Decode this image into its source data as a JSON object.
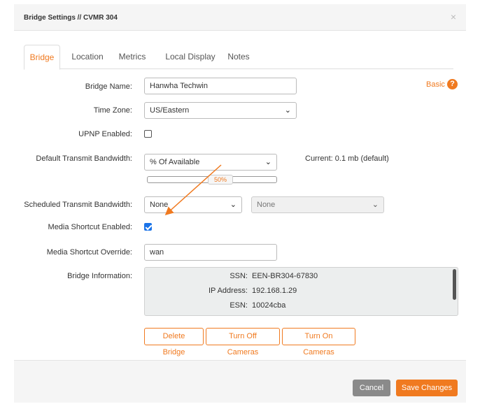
{
  "modal": {
    "title": "Bridge Settings // CVMR 304",
    "close_glyph": "×"
  },
  "tabs": [
    {
      "label": "Bridge",
      "active": true
    },
    {
      "label": "Location"
    },
    {
      "label": "Metrics"
    },
    {
      "label": "Local Display"
    },
    {
      "label": "Notes"
    }
  ],
  "form": {
    "bridge_name_label": "Bridge Name:",
    "bridge_name_value": "Hanwha Techwin",
    "time_zone_label": "Time Zone:",
    "time_zone_value": "US/Eastern",
    "upnp_label": "UPNP Enabled:",
    "upnp_checked": false,
    "bandwidth_label": "Default Transmit Bandwidth:",
    "bandwidth_value": "% Of Available",
    "bandwidth_current": "Current: 0.1 mb (default)",
    "bandwidth_slider_text": "50%",
    "bandwidth_slider_fraction": 0.5,
    "scheduled_label": "Scheduled Transmit Bandwidth:",
    "scheduled_value_1": "None",
    "scheduled_value_2": "None",
    "media_shortcut_label": "Media Shortcut Enabled:",
    "media_shortcut_checked": true,
    "media_override_label": "Media Shortcut Override:",
    "media_override_value": "wan",
    "bridge_info_label": "Bridge Information:"
  },
  "bridge_info": [
    {
      "key": "SSN:",
      "value": "EEN-BR304-67830"
    },
    {
      "key": "IP Address:",
      "value": "192.168.1.29"
    },
    {
      "key": "ESN:",
      "value": "10024cba"
    }
  ],
  "mode_link": "Basic",
  "help_glyph": "?",
  "chevron_glyph": "⌄",
  "actions": {
    "delete": "Delete Bridge",
    "turn_off": "Turn Off Cameras",
    "turn_on": "Turn On Cameras"
  },
  "footer": {
    "cancel": "Cancel",
    "save": "Save Changes"
  },
  "colors": {
    "accent": "#f07a20",
    "checkbox_checked": "#1a73e8",
    "annotation_arrow": "#f07a20"
  }
}
